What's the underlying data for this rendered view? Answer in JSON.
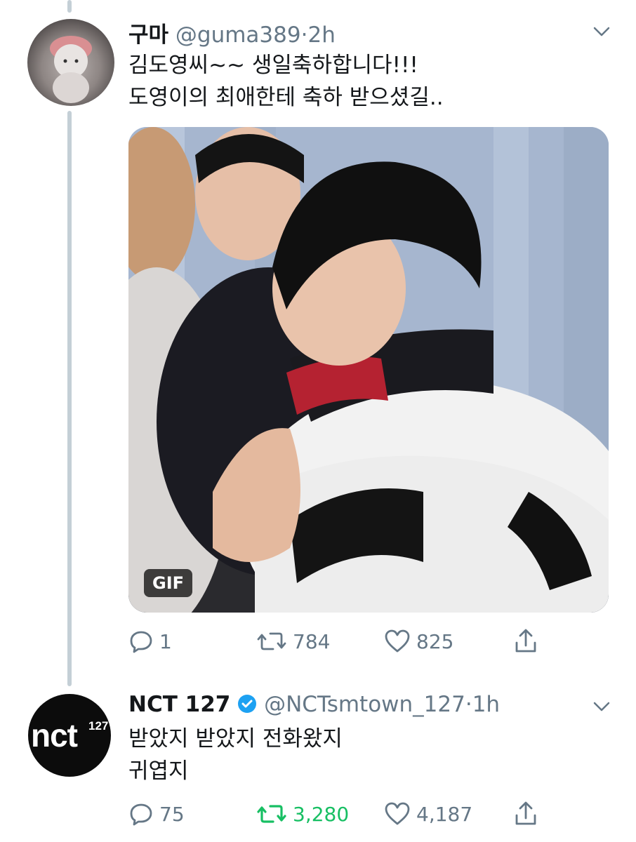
{
  "tweet1": {
    "display_name": "구마",
    "handle": "@guma389",
    "separator": "·",
    "time": "2h",
    "text_lines": [
      "김도영씨~~ 생일축하합니다!!!",
      "도영이의 최애한테 축하 받으셨길.."
    ],
    "media": {
      "badge": "GIF"
    },
    "actions": {
      "replies": "1",
      "retweets": "784",
      "likes": "825"
    }
  },
  "tweet2": {
    "display_name": "NCT 127",
    "verified": true,
    "handle": "@NCTsmtown_127",
    "separator": "·",
    "time": "1h",
    "avatar_text": "nct",
    "avatar_superscript": "127",
    "text_lines": [
      "받았지 받았지 전화왔지",
      "귀엽지"
    ],
    "actions": {
      "replies": "75",
      "retweets": "3,280",
      "likes": "4,187"
    },
    "retweeted": true
  },
  "icons": [
    "reply-icon",
    "retweet-icon",
    "like-icon",
    "share-icon",
    "chevron-down-icon",
    "verified-badge-icon"
  ],
  "colors": {
    "secondary_text": "#657786",
    "retweet_active": "#17bf63",
    "verified": "#1da1f2",
    "thread_line": "#c4cfd6"
  }
}
